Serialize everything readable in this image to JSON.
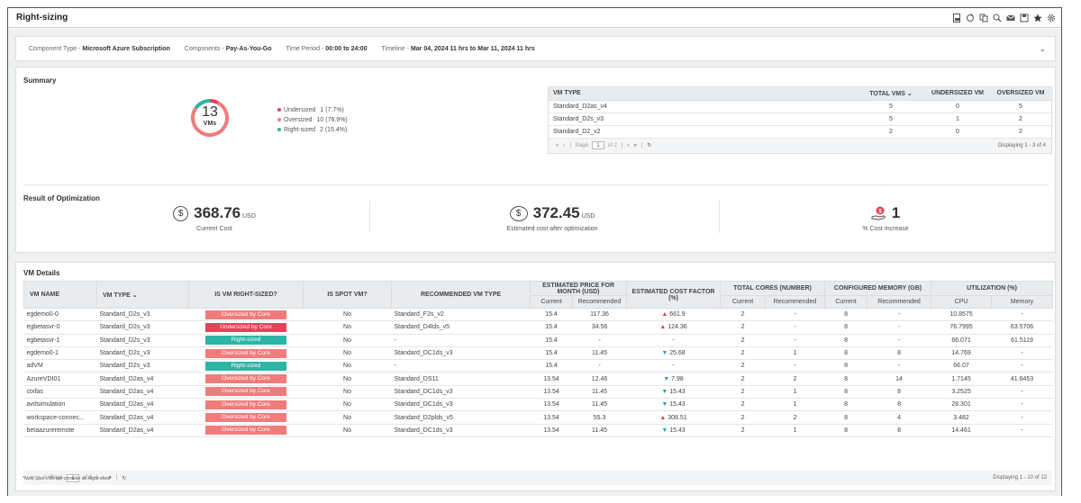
{
  "window": {
    "title": "Right-sizing"
  },
  "toolbar_icons": [
    "export-pdf-icon",
    "refresh-icon",
    "copy-icon",
    "zoom-icon",
    "email-icon",
    "save-icon",
    "favorite-star-icon",
    "settings-icon"
  ],
  "filters": {
    "component_type_label": "Component Type - ",
    "component_type_value": "Microsoft Azure Subscription",
    "components_label": "Components - ",
    "components_value": "Pay-As-You-Go",
    "time_period_label": "Time Period - ",
    "time_period_value": "00:00 to 24:00",
    "timeline_label": "Timeline - ",
    "timeline_value": "Mar 04, 2024 11 hrs to Mar 11, 2024 11 hrs"
  },
  "summary": {
    "title": "Summary",
    "donut": {
      "total": "13",
      "unit": "VMs",
      "segments": [
        {
          "label": "Undersized",
          "value": "1 (7.7%)",
          "fraction": 0.077,
          "color": "#e8415a"
        },
        {
          "label": "Oversized",
          "value": "10 (76.9%)",
          "fraction": 0.769,
          "color": "#f07b7b"
        },
        {
          "label": "Right-sized",
          "value": "2 (15.4%)",
          "fraction": 0.154,
          "color": "#2bb5a5"
        }
      ]
    },
    "vm_type_table": {
      "headers": [
        "VM TYPE",
        "TOTAL VMS",
        "UNDERSIZED VM",
        "OVERSIZED VM"
      ],
      "rows": [
        [
          "Standard_D2as_v4",
          "5",
          "0",
          "5"
        ],
        [
          "Standard_D2s_v3",
          "5",
          "1",
          "2"
        ],
        [
          "Standard_D2_v2",
          "2",
          "0",
          "2"
        ]
      ],
      "pager": {
        "page_label": "Page",
        "page": "1",
        "of": "of 2",
        "display": "Displaying 1 - 3 of 4"
      }
    }
  },
  "optimization": {
    "title": "Result of Optimization",
    "current_cost": {
      "value": "368.76",
      "currency": "USD",
      "label": "Current Cost"
    },
    "estimated_cost": {
      "value": "372.45",
      "currency": "USD",
      "label": "Estimated cost after optimization"
    },
    "cost_increase": {
      "value": "1",
      "label": "% Cost Increase"
    }
  },
  "vm_details": {
    "title": "VM Details",
    "headers": {
      "vm_name": "VM NAME",
      "vm_type": "VM TYPE",
      "right_sized": "IS VM RIGHT-SIZED?",
      "spot": "IS SPOT VM?",
      "recommended": "RECOMMENDED VM TYPE",
      "est_price": "ESTIMATED PRICE FOR MONTH (USD)",
      "cost_factor": "ESTIMATED COST FACTOR (%)",
      "cores": "TOTAL CORES (NUMBER)",
      "memory": "CONFIGURED MEMORY (GB)",
      "utilization": "UTILIZATION (%)",
      "current": "Current",
      "recommended_sub": "Recommended",
      "cpu": "CPU",
      "mem": "Memory"
    },
    "rows": [
      {
        "name": "egdemo0-0",
        "type": "Standard_D2s_v3",
        "status": "Oversized by Core",
        "status_kind": "over",
        "spot": "No",
        "rec_type": "Standard_F2s_v2",
        "price_cur": "15.4",
        "price_rec": "117.36",
        "factor": "661.9",
        "trend": "up",
        "cores_cur": "2",
        "cores_rec": "-",
        "mem_cur": "8",
        "mem_rec": "-",
        "cpu": "10.8575",
        "memory": "-"
      },
      {
        "name": "egbetasvr-0",
        "type": "Standard_D2s_v3",
        "status": "Undersized by Core",
        "status_kind": "under",
        "spot": "No",
        "rec_type": "Standard_D4lds_v5",
        "price_cur": "15.4",
        "price_rec": "34.56",
        "factor": "124.36",
        "trend": "up",
        "cores_cur": "2",
        "cores_rec": "-",
        "mem_cur": "8",
        "mem_rec": "-",
        "cpu": "76.7995",
        "memory": "63.5706"
      },
      {
        "name": "egbetasvr-1",
        "type": "Standard_D2s_v3",
        "status": "Right-sized",
        "status_kind": "right",
        "spot": "No",
        "rec_type": "-",
        "price_cur": "15.4",
        "price_rec": "-",
        "factor": "-",
        "trend": "",
        "cores_cur": "2",
        "cores_rec": "-",
        "mem_cur": "8",
        "mem_rec": "-",
        "cpu": "66.071",
        "memory": "61.5119"
      },
      {
        "name": "egdemo0-1",
        "type": "Standard_D2s_v3",
        "status": "Oversized by Core",
        "status_kind": "over",
        "spot": "No",
        "rec_type": "Standard_DC1ds_v3",
        "price_cur": "15.4",
        "price_rec": "11.45",
        "factor": "25.68",
        "trend": "down",
        "cores_cur": "2",
        "cores_rec": "1",
        "mem_cur": "8",
        "mem_rec": "8",
        "cpu": "14.769",
        "memory": "-"
      },
      {
        "name": "adVM",
        "type": "Standard_D2s_v3",
        "status": "Right-sized",
        "status_kind": "right",
        "spot": "No",
        "rec_type": "-",
        "price_cur": "15.4",
        "price_rec": "-",
        "factor": "-",
        "trend": "",
        "cores_cur": "2",
        "cores_rec": "-",
        "mem_cur": "8",
        "mem_rec": "-",
        "cpu": "66.07",
        "memory": "-"
      },
      {
        "name": "AzureVDI01",
        "type": "Standard_D2as_v4",
        "status": "Oversized by Core",
        "status_kind": "over",
        "spot": "No",
        "rec_type": "Standard_DS11",
        "price_cur": "13.54",
        "price_rec": "12.46",
        "factor": "7.98",
        "trend": "down",
        "cores_cur": "2",
        "cores_rec": "2",
        "mem_cur": "8",
        "mem_rec": "14",
        "cpu": "1.7145",
        "memory": "41.6453"
      },
      {
        "name": "ctxfas",
        "type": "Standard_D2as_v4",
        "status": "Oversized by Core",
        "status_kind": "over",
        "spot": "No",
        "rec_type": "Standard_DC1ds_v3",
        "price_cur": "13.54",
        "price_rec": "11.45",
        "factor": "15.43",
        "trend": "down",
        "cores_cur": "2",
        "cores_rec": "1",
        "mem_cur": "8",
        "mem_rec": "8",
        "cpu": "3.2525",
        "memory": "-"
      },
      {
        "name": "avdsimulation",
        "type": "Standard_D2as_v4",
        "status": "Oversized by Core",
        "status_kind": "over",
        "spot": "No",
        "rec_type": "Standard_DC1ds_v3",
        "price_cur": "13.54",
        "price_rec": "11.45",
        "factor": "15.43",
        "trend": "down",
        "cores_cur": "2",
        "cores_rec": "1",
        "mem_cur": "8",
        "mem_rec": "8",
        "cpu": "28.301",
        "memory": "-"
      },
      {
        "name": "workspace-connec...",
        "type": "Standard_D2as_v4",
        "status": "Oversized by Core",
        "status_kind": "over",
        "spot": "No",
        "rec_type": "Standard_D2plds_v5",
        "price_cur": "13.54",
        "price_rec": "55.3",
        "factor": "308.51",
        "trend": "up",
        "cores_cur": "2",
        "cores_rec": "2",
        "mem_cur": "8",
        "mem_rec": "4",
        "cpu": "3.482",
        "memory": "-"
      },
      {
        "name": "betaazureremote",
        "type": "Standard_D2as_v4",
        "status": "Oversized by Core",
        "status_kind": "over",
        "spot": "No",
        "rec_type": "Standard_DC1ds_v3",
        "price_cur": "13.54",
        "price_rec": "11.45",
        "factor": "15.43",
        "trend": "down",
        "cores_cur": "2",
        "cores_rec": "1",
        "mem_cur": "8",
        "mem_rec": "8",
        "cpu": "14.461",
        "memory": "-"
      }
    ],
    "pager": {
      "page_label": "Page",
      "page": "1",
      "of": "of 2",
      "display": "Displaying 1 - 10 of 13"
    }
  },
  "footnote": "*Note:Spot VMs are consider as Right-sized"
}
